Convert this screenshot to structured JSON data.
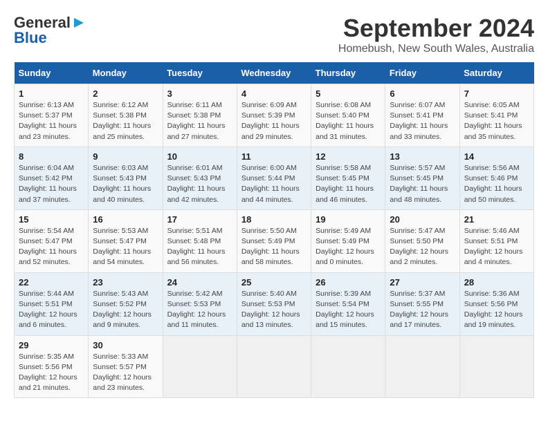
{
  "header": {
    "logo_general": "General",
    "logo_blue": "Blue",
    "title": "September 2024",
    "subtitle": "Homebush, New South Wales, Australia"
  },
  "days_of_week": [
    "Sunday",
    "Monday",
    "Tuesday",
    "Wednesday",
    "Thursday",
    "Friday",
    "Saturday"
  ],
  "weeks": [
    [
      {
        "day": "1",
        "info": "Sunrise: 6:13 AM\nSunset: 5:37 PM\nDaylight: 11 hours\nand 23 minutes."
      },
      {
        "day": "2",
        "info": "Sunrise: 6:12 AM\nSunset: 5:38 PM\nDaylight: 11 hours\nand 25 minutes."
      },
      {
        "day": "3",
        "info": "Sunrise: 6:11 AM\nSunset: 5:38 PM\nDaylight: 11 hours\nand 27 minutes."
      },
      {
        "day": "4",
        "info": "Sunrise: 6:09 AM\nSunset: 5:39 PM\nDaylight: 11 hours\nand 29 minutes."
      },
      {
        "day": "5",
        "info": "Sunrise: 6:08 AM\nSunset: 5:40 PM\nDaylight: 11 hours\nand 31 minutes."
      },
      {
        "day": "6",
        "info": "Sunrise: 6:07 AM\nSunset: 5:41 PM\nDaylight: 11 hours\nand 33 minutes."
      },
      {
        "day": "7",
        "info": "Sunrise: 6:05 AM\nSunset: 5:41 PM\nDaylight: 11 hours\nand 35 minutes."
      }
    ],
    [
      {
        "day": "8",
        "info": "Sunrise: 6:04 AM\nSunset: 5:42 PM\nDaylight: 11 hours\nand 37 minutes."
      },
      {
        "day": "9",
        "info": "Sunrise: 6:03 AM\nSunset: 5:43 PM\nDaylight: 11 hours\nand 40 minutes."
      },
      {
        "day": "10",
        "info": "Sunrise: 6:01 AM\nSunset: 5:43 PM\nDaylight: 11 hours\nand 42 minutes."
      },
      {
        "day": "11",
        "info": "Sunrise: 6:00 AM\nSunset: 5:44 PM\nDaylight: 11 hours\nand 44 minutes."
      },
      {
        "day": "12",
        "info": "Sunrise: 5:58 AM\nSunset: 5:45 PM\nDaylight: 11 hours\nand 46 minutes."
      },
      {
        "day": "13",
        "info": "Sunrise: 5:57 AM\nSunset: 5:45 PM\nDaylight: 11 hours\nand 48 minutes."
      },
      {
        "day": "14",
        "info": "Sunrise: 5:56 AM\nSunset: 5:46 PM\nDaylight: 11 hours\nand 50 minutes."
      }
    ],
    [
      {
        "day": "15",
        "info": "Sunrise: 5:54 AM\nSunset: 5:47 PM\nDaylight: 11 hours\nand 52 minutes."
      },
      {
        "day": "16",
        "info": "Sunrise: 5:53 AM\nSunset: 5:47 PM\nDaylight: 11 hours\nand 54 minutes."
      },
      {
        "day": "17",
        "info": "Sunrise: 5:51 AM\nSunset: 5:48 PM\nDaylight: 11 hours\nand 56 minutes."
      },
      {
        "day": "18",
        "info": "Sunrise: 5:50 AM\nSunset: 5:49 PM\nDaylight: 11 hours\nand 58 minutes."
      },
      {
        "day": "19",
        "info": "Sunrise: 5:49 AM\nSunset: 5:49 PM\nDaylight: 12 hours\nand 0 minutes."
      },
      {
        "day": "20",
        "info": "Sunrise: 5:47 AM\nSunset: 5:50 PM\nDaylight: 12 hours\nand 2 minutes."
      },
      {
        "day": "21",
        "info": "Sunrise: 5:46 AM\nSunset: 5:51 PM\nDaylight: 12 hours\nand 4 minutes."
      }
    ],
    [
      {
        "day": "22",
        "info": "Sunrise: 5:44 AM\nSunset: 5:51 PM\nDaylight: 12 hours\nand 6 minutes."
      },
      {
        "day": "23",
        "info": "Sunrise: 5:43 AM\nSunset: 5:52 PM\nDaylight: 12 hours\nand 9 minutes."
      },
      {
        "day": "24",
        "info": "Sunrise: 5:42 AM\nSunset: 5:53 PM\nDaylight: 12 hours\nand 11 minutes."
      },
      {
        "day": "25",
        "info": "Sunrise: 5:40 AM\nSunset: 5:53 PM\nDaylight: 12 hours\nand 13 minutes."
      },
      {
        "day": "26",
        "info": "Sunrise: 5:39 AM\nSunset: 5:54 PM\nDaylight: 12 hours\nand 15 minutes."
      },
      {
        "day": "27",
        "info": "Sunrise: 5:37 AM\nSunset: 5:55 PM\nDaylight: 12 hours\nand 17 minutes."
      },
      {
        "day": "28",
        "info": "Sunrise: 5:36 AM\nSunset: 5:56 PM\nDaylight: 12 hours\nand 19 minutes."
      }
    ],
    [
      {
        "day": "29",
        "info": "Sunrise: 5:35 AM\nSunset: 5:56 PM\nDaylight: 12 hours\nand 21 minutes."
      },
      {
        "day": "30",
        "info": "Sunrise: 5:33 AM\nSunset: 5:57 PM\nDaylight: 12 hours\nand 23 minutes."
      },
      null,
      null,
      null,
      null,
      null
    ]
  ]
}
